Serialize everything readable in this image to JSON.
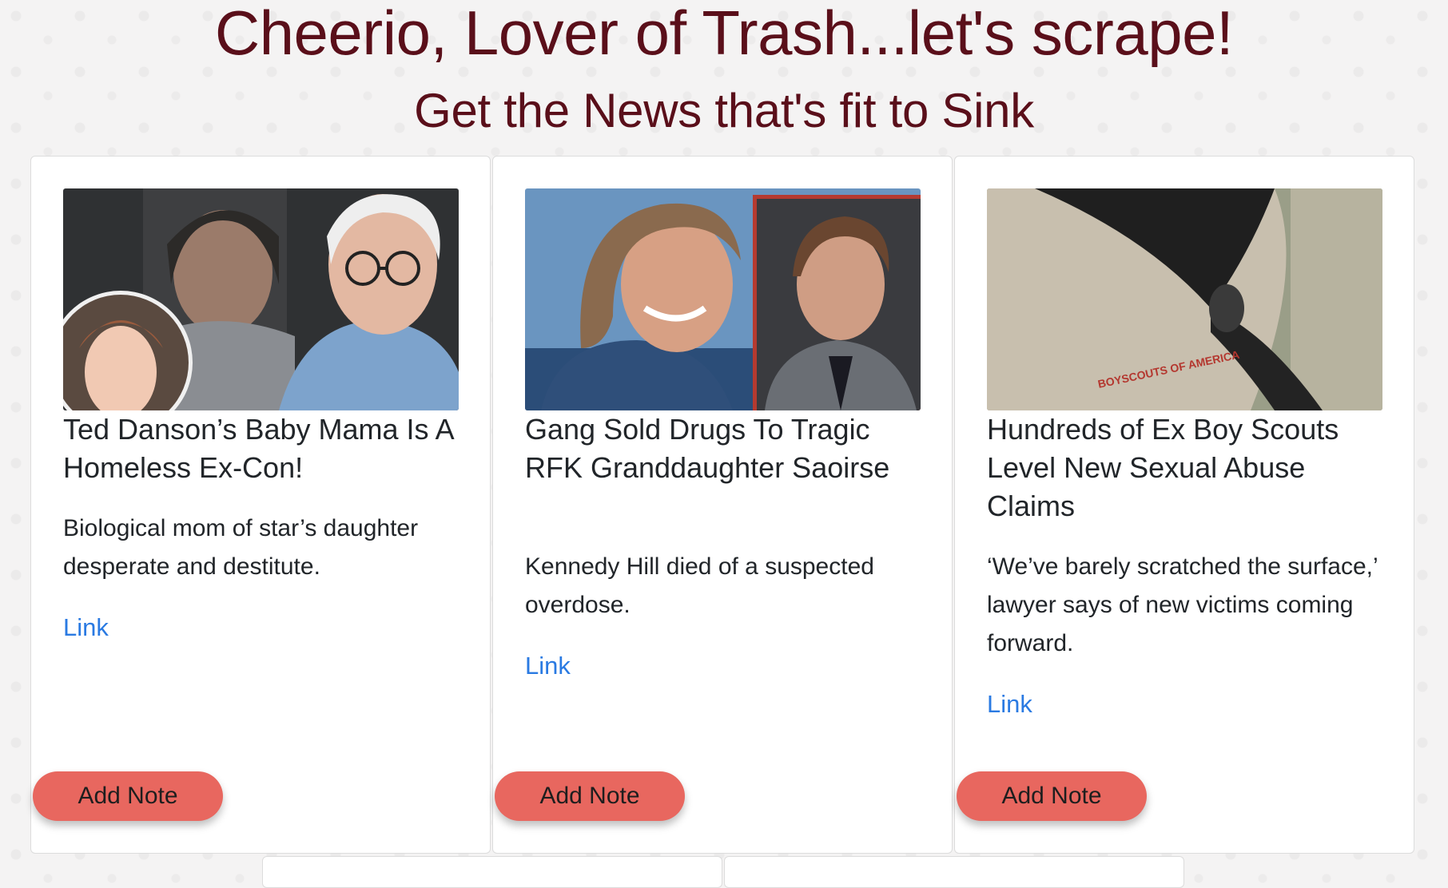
{
  "header": {
    "title": "Cheerio, Lover of Trash...let's scrape!",
    "subtitle": "Get the News that's fit to Sink"
  },
  "articles": [
    {
      "image_icon": "photo-icon",
      "title": "Ted Danson’s Baby Mama Is A Homeless Ex-Con!",
      "summary": "Biological mom of star’s daughter desperate and destitute.",
      "link_label": "Link",
      "button_label": "Add Note"
    },
    {
      "image_icon": "photo-icon",
      "title": "Gang Sold Drugs To Tragic RFK Granddaughter Saoirse",
      "summary": "Kennedy Hill died of a suspected overdose.",
      "link_label": "Link",
      "button_label": "Add Note"
    },
    {
      "image_icon": "photo-icon",
      "title": "Hundreds of Ex Boy Scouts Level New Sexual Abuse Claims",
      "summary": "‘We’ve barely scratched the surface,’ lawyer says of new victims coming forward.",
      "link_label": "Link",
      "button_label": "Add Note",
      "image_text": "BOYSCOUTS OF AMERICA"
    }
  ],
  "colors": {
    "heading": "#5a0f1a",
    "link": "#2a7ae2",
    "button": "#e8675f"
  }
}
